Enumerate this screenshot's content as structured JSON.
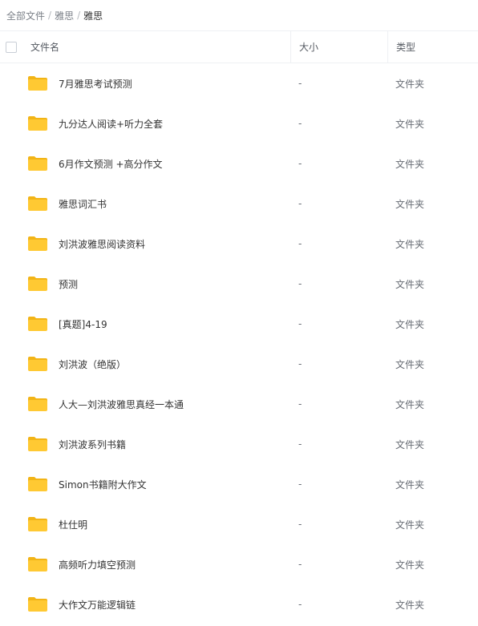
{
  "breadcrumb": {
    "items": [
      "全部文件",
      "雅思"
    ],
    "separator": "/",
    "current": "雅思"
  },
  "table": {
    "headers": {
      "name": "文件名",
      "size": "大小",
      "type": "类型"
    },
    "rows": [
      {
        "name": "7月雅思考试预测",
        "size": "-",
        "type": "文件夹"
      },
      {
        "name": "九分达人阅读+听力全套",
        "size": "-",
        "type": "文件夹"
      },
      {
        "name": "6月作文预测 +高分作文",
        "size": "-",
        "type": "文件夹"
      },
      {
        "name": "雅思词汇书",
        "size": "-",
        "type": "文件夹"
      },
      {
        "name": "刘洪波雅思阅读资料",
        "size": "-",
        "type": "文件夹"
      },
      {
        "name": "预测",
        "size": "-",
        "type": "文件夹"
      },
      {
        "name": "[真题]4-19",
        "size": "-",
        "type": "文件夹"
      },
      {
        "name": "刘洪波（绝版）",
        "size": "-",
        "type": "文件夹"
      },
      {
        "name": "人大—刘洪波雅思真经一本通",
        "size": "-",
        "type": "文件夹"
      },
      {
        "name": "刘洪波系列书籍",
        "size": "-",
        "type": "文件夹"
      },
      {
        "name": "Simon书籍附大作文",
        "size": "-",
        "type": "文件夹"
      },
      {
        "name": "杜仕明",
        "size": "-",
        "type": "文件夹"
      },
      {
        "name": "高频听力填空预测",
        "size": "-",
        "type": "文件夹"
      },
      {
        "name": "大作文万能逻辑链",
        "size": "-",
        "type": "文件夹"
      }
    ]
  },
  "colors": {
    "folder": "#ffc933",
    "folder_tab": "#f2b416",
    "border": "#eef0f3"
  },
  "icons": {
    "folder": "folder-icon",
    "checkbox": "select-all-checkbox"
  }
}
